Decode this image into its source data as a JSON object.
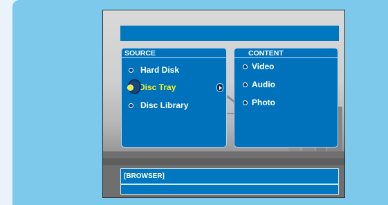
{
  "menu": {
    "source": {
      "header": "SOURCE",
      "items": [
        {
          "label": "Hard Disk",
          "selected": false
        },
        {
          "label": "Disc Tray",
          "selected": true
        },
        {
          "label": "Disc Library",
          "selected": false
        }
      ]
    },
    "content": {
      "header": "CONTENT",
      "items": [
        {
          "label": "Video"
        },
        {
          "label": "Audio"
        },
        {
          "label": "Photo"
        }
      ]
    },
    "footer": {
      "label": "[BROWSER]"
    }
  },
  "colors": {
    "frame": "#7dc9ec",
    "panel": "#0072bb",
    "selected_text": "#f4ee2a"
  },
  "icons": [
    "selection-cursor-icon",
    "right-arrow-icon",
    "radio-bullet-icon"
  ]
}
